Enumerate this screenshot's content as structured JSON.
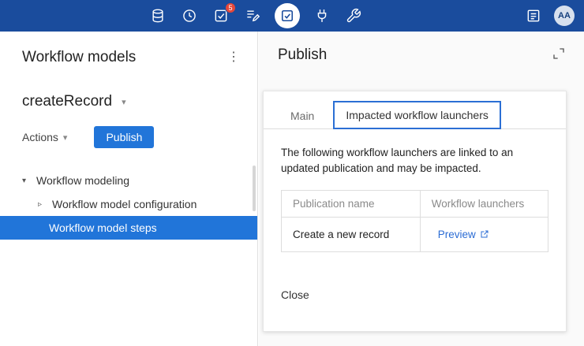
{
  "topbar": {
    "badge_count": "5",
    "avatar_initials": "AA",
    "icon_names": [
      "database-icon",
      "clock-icon",
      "tasks-icon",
      "audit-icon",
      "checklist-icon",
      "plug-icon",
      "wrench-icon",
      "activity-feed-icon"
    ]
  },
  "icons": {
    "kebab": "⋮",
    "caret_down": "▾",
    "caret_right": "▹"
  },
  "left_panel": {
    "title": "Workflow models",
    "model_name": "createRecord",
    "actions_label": "Actions",
    "publish_button": "Publish",
    "tree": {
      "root_label": "Workflow modeling",
      "items": [
        {
          "label": "Workflow model configuration",
          "selected": false
        },
        {
          "label": "Workflow model steps",
          "selected": true
        }
      ]
    }
  },
  "main": {
    "title": "Publish",
    "tabs": [
      {
        "label": "Main"
      },
      {
        "label": "Impacted workflow launchers"
      }
    ],
    "description": "The following workflow launchers are linked to an updated publication and may be impacted.",
    "table": {
      "headers": [
        "Publication name",
        "Workflow launchers"
      ],
      "rows": [
        {
          "publication_name": "Create a new record",
          "launcher_link": "Preview"
        }
      ]
    },
    "close_label": "Close"
  },
  "colors": {
    "topbar_bg": "#1a4c9d",
    "accent_blue": "#2175d9",
    "link_blue": "#2b6cd4",
    "badge_red": "#e5473a"
  }
}
